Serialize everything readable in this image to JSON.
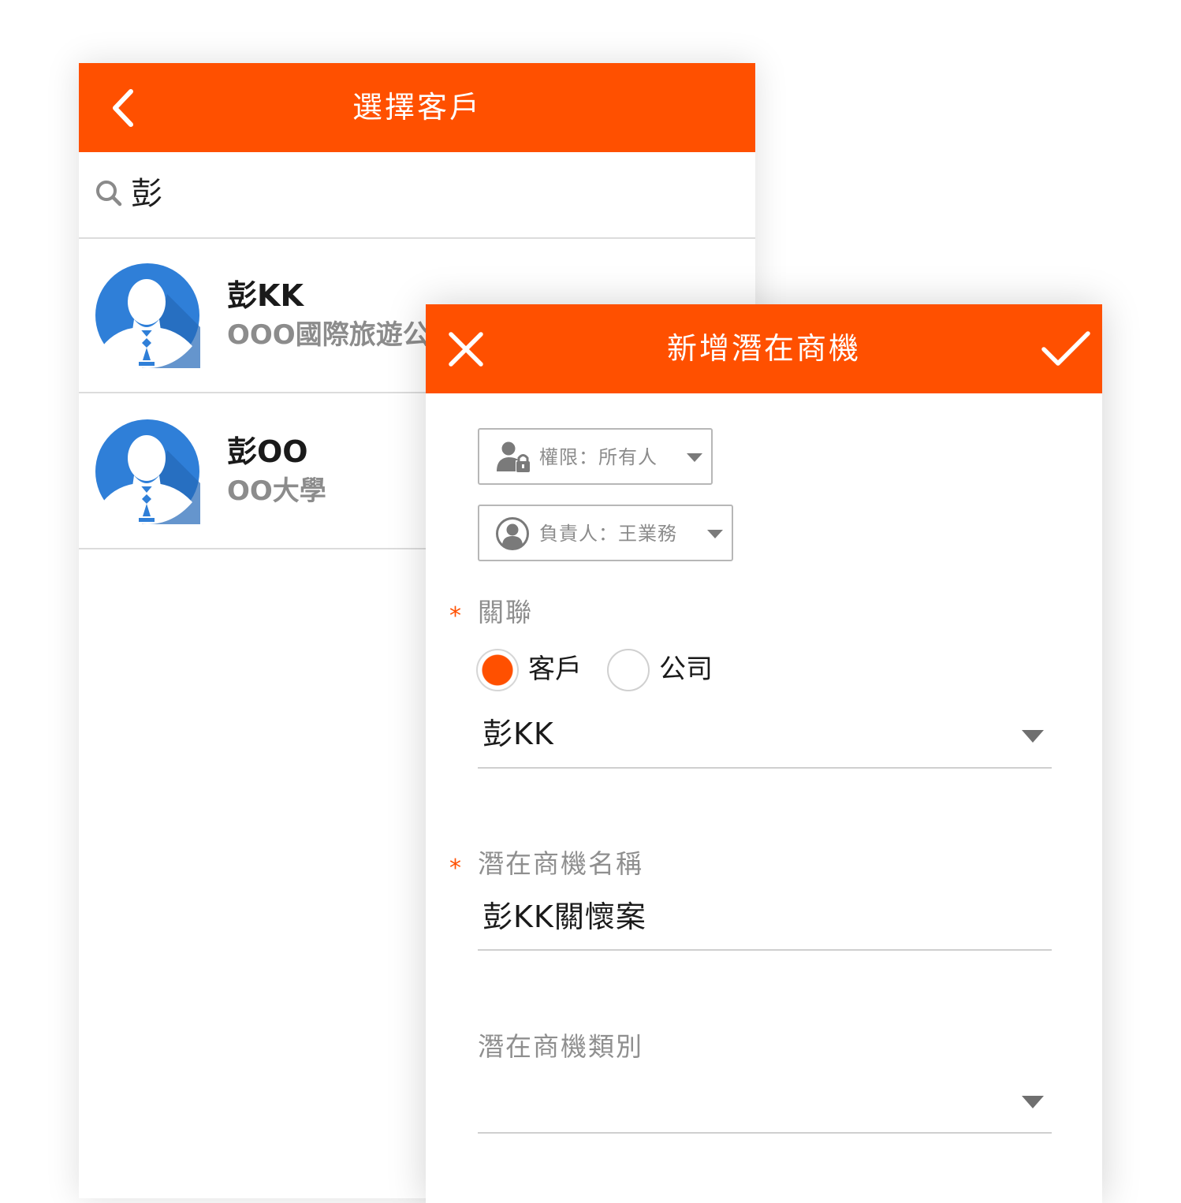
{
  "colors": {
    "accent": "#FF5000",
    "avatar_blue": "#2F7FD8"
  },
  "select_customer": {
    "title": "選擇客戶",
    "back_icon": "chevron-left-icon",
    "search": {
      "icon": "search-icon",
      "query": "彭"
    },
    "customers": [
      {
        "name": "彭KK",
        "subtitle": "OOO國際旅遊公",
        "avatar": "user-avatar-icon"
      },
      {
        "name": "彭OO",
        "subtitle": "OO大學",
        "avatar": "user-avatar-icon"
      }
    ]
  },
  "new_opportunity": {
    "title": "新增潛在商機",
    "close_icon": "close-icon",
    "confirm_icon": "checkmark-icon",
    "permission": {
      "icon": "user-lock-icon",
      "label": "權限：",
      "value": "所有人"
    },
    "owner": {
      "icon": "user-circle-icon",
      "label": "負責人：",
      "value": "王業務"
    },
    "required_mark": "*",
    "relation": {
      "label": "關聯",
      "options": [
        {
          "label": "客戶",
          "selected": true
        },
        {
          "label": "公司",
          "selected": false
        }
      ],
      "selected_value": "彭KK"
    },
    "name_field": {
      "label": "潛在商機名稱",
      "value": "彭KK關懷案"
    },
    "category_field": {
      "label": "潛在商機類別",
      "value": ""
    }
  }
}
